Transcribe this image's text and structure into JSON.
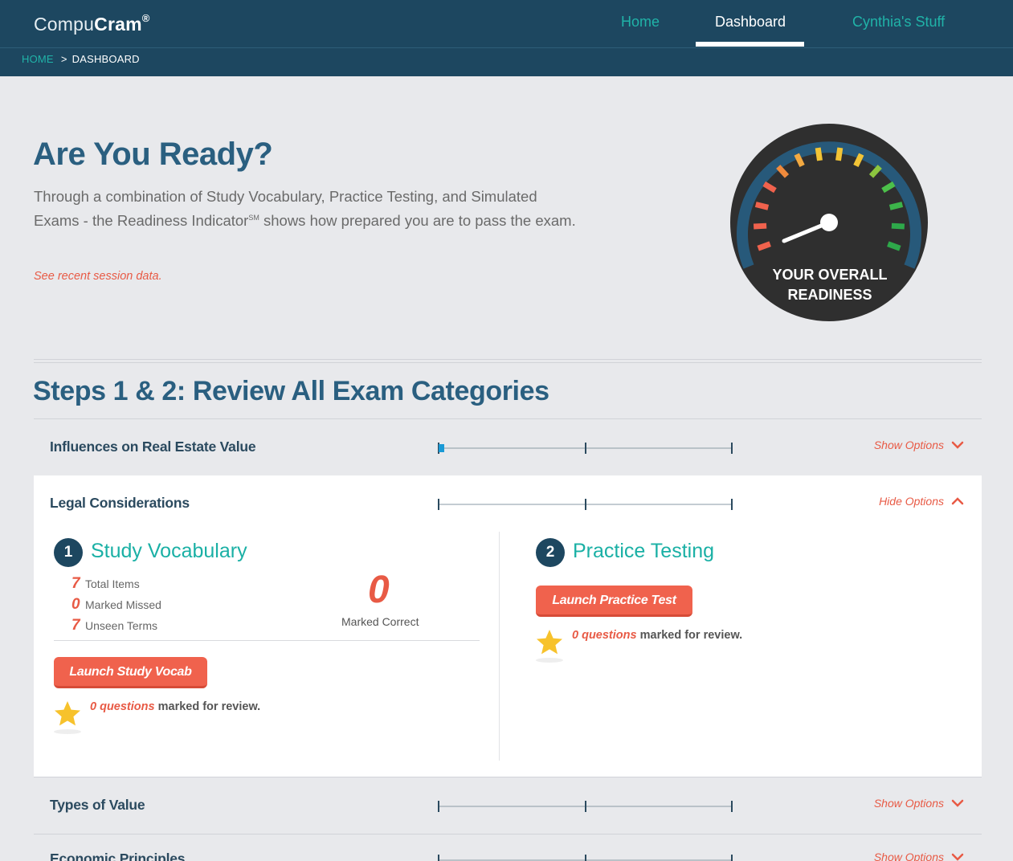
{
  "header": {
    "logo_light": "Compu",
    "logo_bold": "Cram",
    "logo_mark": "®",
    "nav": {
      "home": "Home",
      "dashboard": "Dashboard",
      "stuff": "Cynthia's Stuff"
    }
  },
  "breadcrumb": {
    "home": "HOME",
    "sep": ">",
    "current": "DASHBOARD"
  },
  "hero": {
    "title": "Are You Ready?",
    "desc_part1": "Through a combination of Study Vocabulary, Practice Testing, and Simulated Exams - the Readiness Indicator",
    "desc_sup": "SM",
    "desc_part2": " shows how prepared you are to pass the exam.",
    "session_link": "See recent session data.",
    "gauge_line1": "YOUR OVERALL",
    "gauge_line2": "READINESS"
  },
  "section": {
    "title": "Steps 1 & 2: Review All Exam Categories"
  },
  "categories": [
    {
      "name": "Influences on Real Estate Value",
      "toggle": "Show Options",
      "progress": 0.01
    },
    {
      "name": "Legal Considerations",
      "toggle": "Hide Options",
      "progress": 0
    },
    {
      "name": "Types of Value",
      "toggle": "Show Options",
      "progress": 0
    },
    {
      "name": "Economic Principles",
      "toggle": "Show Options",
      "progress": 0
    }
  ],
  "vocab": {
    "step": "1",
    "title": "Study Vocabulary",
    "stats": [
      {
        "num": "7",
        "label": "Total Items"
      },
      {
        "num": "0",
        "label": "Marked Missed"
      },
      {
        "num": "7",
        "label": "Unseen Terms"
      }
    ],
    "correct_num": "0",
    "correct_label": "Marked Correct",
    "button": "Launch Study Vocab",
    "review_q": "0 questions",
    "review_rest": " marked for review."
  },
  "practice": {
    "step": "2",
    "title": "Practice Testing",
    "button": "Launch Practice Test",
    "review_q": "0 questions",
    "review_rest": " marked for review."
  },
  "colors": {
    "header": "#1d4760",
    "accent_teal": "#1ab0a5",
    "accent_red": "#f0624d",
    "title_blue": "#2a5f80"
  },
  "icons": [
    "chevron-down-icon",
    "chevron-up-icon",
    "star-icon"
  ]
}
